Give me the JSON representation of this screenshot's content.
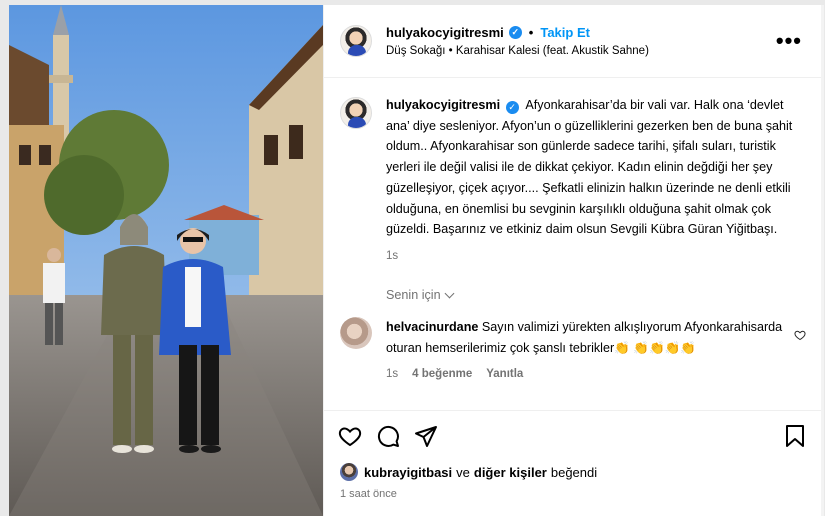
{
  "post": {
    "username": "hulyakocyigitresmi",
    "follow_label": "Takip Et",
    "dot": "•",
    "music": "Düş Sokağı • Karahisar Kalesi (feat. Akustik Sahne)",
    "more": "•••"
  },
  "caption": {
    "username": "hulyakocyigitresmi",
    "text": "Afyonkarahisar’da bir vali var. Halk ona ‘devlet ana’ diye sesleniyor. Afyon’un o güzelliklerini gezerken ben de buna şahit oldum.. Afyonkarahisar son günlerde sadece tarihi, şifalı suları, turistik yerleri ile değil valisi ile de dikkat çekiyor. Kadın elinin değdiği her şey güzelleşiyor, çiçek açıyor.... Şefkatli elinizin halkın üzerinde ne denli etkili olduğuna, en önemlisi bu sevginin karşılıklı olduğuna şahit olmak çok güzeldi. Başarınız ve etkiniz daim olsun Sevgili Kübra Güran Yiğitbaşı.",
    "time": "1s"
  },
  "for_you_label": "Senin için",
  "comment": {
    "username": "helvacinurdane",
    "text": "Sayın valimizi yürekten alkışlıyorum Afyonkarahisarda oturan hemserilerimiz çok şanslı tebrikler👏 👏👏👏👏",
    "time": "1s",
    "likes": "4 beğenme",
    "reply": "Yanıtla"
  },
  "likes": {
    "user": "kubrayigitbasi",
    "connector": "ve",
    "others": "diğer kişiler",
    "suffix": "beğendi"
  },
  "posted": "1 saat önce",
  "colors": {
    "accent": "#0095f6",
    "verified": "#1a8cf0",
    "muted": "#737373"
  }
}
